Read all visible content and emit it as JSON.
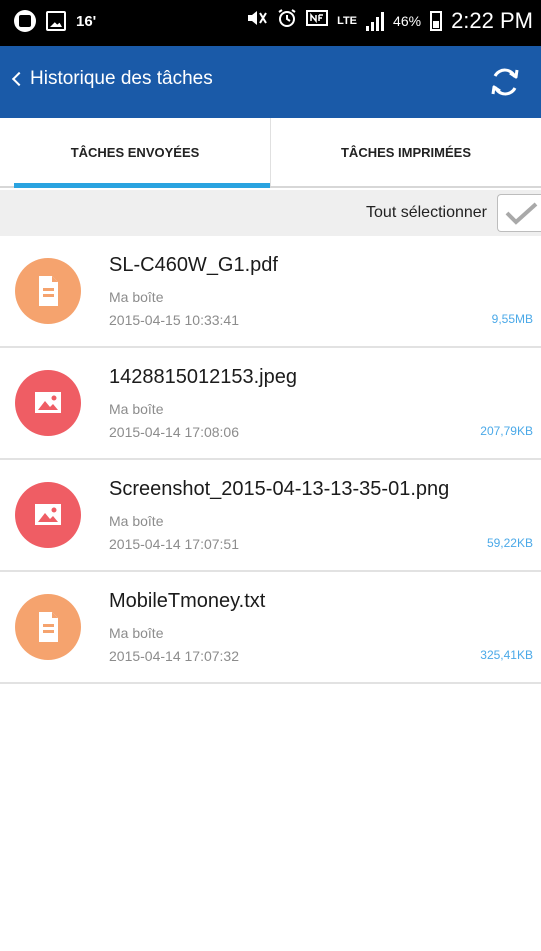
{
  "status_bar": {
    "temperature": "16'",
    "signal_type": "LTE",
    "battery_percent": "46%",
    "time": "2:22 PM"
  },
  "app_bar": {
    "title": "Historique des tâches",
    "back_icon": "chevron-left-icon",
    "refresh_icon": "refresh-icon",
    "color": "#1a5aa8"
  },
  "tabs": [
    {
      "label": "TÂCHES ENVOYÉES",
      "active": true
    },
    {
      "label": "TÂCHES IMPRIMÉES",
      "active": false
    }
  ],
  "select_all": {
    "label": "Tout sélectionner"
  },
  "items": [
    {
      "name": "SL-C460W_G1.pdf",
      "location": "Ma boîte",
      "date": "2015-04-15 10:33:41",
      "size": "9,55MB",
      "icon": "document-icon"
    },
    {
      "name": "1428815012153.jpeg",
      "location": "Ma boîte",
      "date": "2015-04-14 17:08:06",
      "size": "207,79KB",
      "icon": "image-icon"
    },
    {
      "name": "Screenshot_2015-04-13-13-35-01.png",
      "location": "Ma boîte",
      "date": "2015-04-14 17:07:51",
      "size": "59,22KB",
      "icon": "image-icon"
    },
    {
      "name": "MobileTmoney.txt",
      "location": "Ma boîte",
      "date": "2015-04-14 17:07:32",
      "size": "325,41KB",
      "icon": "document-icon"
    }
  ],
  "colors": {
    "accent_tab": "#2aa3e0",
    "doc_icon": "#f5a36e",
    "image_icon": "#ef5d64",
    "size_text": "#4ba9e8"
  }
}
